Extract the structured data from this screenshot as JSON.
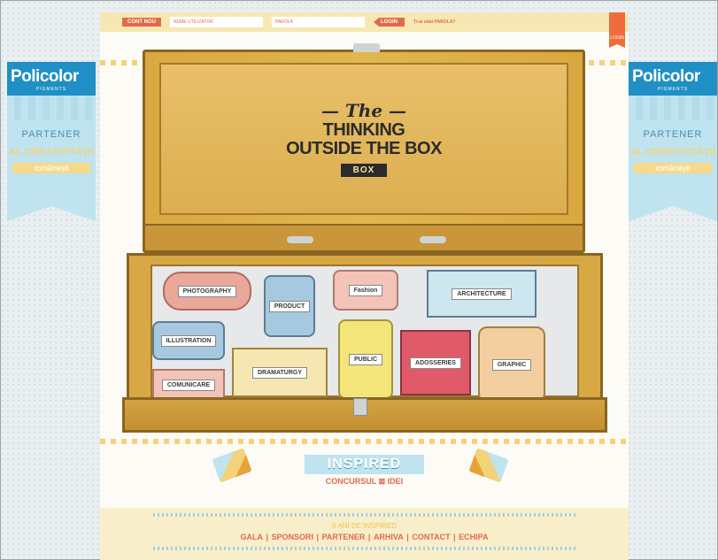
{
  "banners": {
    "logo": "Policolor",
    "logo_sub": "PIGMENTS",
    "partner": "PARTENER",
    "creativity": "AL CREATIVITĂȚII",
    "romanian": "românești"
  },
  "topbar": {
    "account_button": "CONT NOU",
    "username_placeholder": "NUME UTILIZATOR",
    "password_placeholder": "PAROLA",
    "login_button": "LOGIN",
    "forgot": "Ți-ai uitat PAROLA?",
    "ribbon": "LOGIN"
  },
  "lid": {
    "the": "The",
    "line1": "THINKING",
    "line2": "OUTSIDE THE BOX",
    "box": "BOX"
  },
  "tray": {
    "items": [
      "PHOTOGRAPHY",
      "PRODUCT",
      "Fashion",
      "ARCHITECTURE",
      "ILLUSTRATION",
      "DRAMATURGY",
      "PUBLIC",
      "ADOSSERIES",
      "GRAPHIC",
      "COMUNICARE"
    ]
  },
  "footer": {
    "inspired": "INSPIRED",
    "concurs": "CONCURSUL ⊠ IDEI",
    "years": "6 ANI DE INSPIRED",
    "links": [
      "GALA",
      "SPONSORI",
      "PARTENER",
      "ARHIVA",
      "CONTACT",
      "ECHIPA"
    ]
  },
  "colors": {
    "accent": "#e26a4a",
    "wood": "#d9a83f",
    "sky": "#bfe3ef",
    "brand_blue": "#1f8fc5"
  }
}
